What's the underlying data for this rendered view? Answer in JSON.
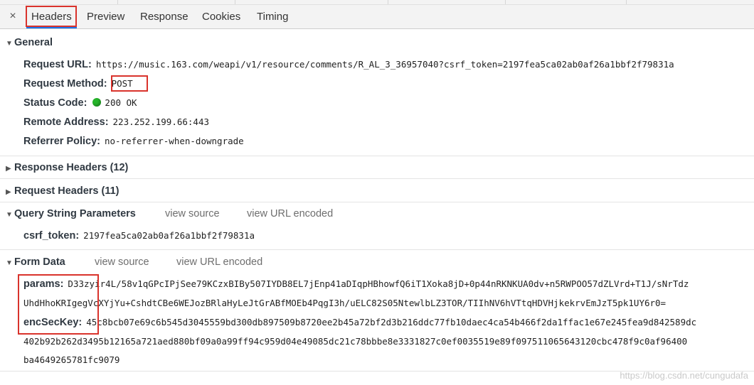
{
  "tabs": {
    "close": "×",
    "headers": "Headers",
    "preview": "Preview",
    "response": "Response",
    "cookies": "Cookies",
    "timing": "Timing"
  },
  "general": {
    "title": "General",
    "request_url_label": "Request URL:",
    "request_url": "https://music.163.com/weapi/v1/resource/comments/R_AL_3_36957040?csrf_token=2197fea5ca02ab0af26a1bbf2f79831a",
    "request_method_label": "Request Method:",
    "request_method": "POST",
    "status_code_label": "Status Code:",
    "status_code": "200 OK",
    "remote_address_label": "Remote Address:",
    "remote_address": "223.252.199.66:443",
    "referrer_policy_label": "Referrer Policy:",
    "referrer_policy": "no-referrer-when-downgrade"
  },
  "response_headers": {
    "title": "Response Headers (12)"
  },
  "request_headers": {
    "title": "Request Headers (11)"
  },
  "query_string": {
    "title": "Query String Parameters",
    "view_source": "view source",
    "view_url_encoded": "view URL encoded",
    "csrf_label": "csrf_token:",
    "csrf_value": "2197fea5ca02ab0af26a1bbf2f79831a"
  },
  "form_data": {
    "title": "Form Data",
    "view_source": "view source",
    "view_url_encoded": "view URL encoded",
    "params_label": "params:",
    "params_line1": "D33zyir4L/58v1qGPcIPjSee79KCzxBIBy507IYDB8EL7jEnp41aDIqpHBhowfQ6iT1Xoka8jD+0p44nRKNKUA0dv+n5RWPOO57dZLVrd+T1J/sNrTdz",
    "params_line2": "UhdHhoKRIgegVcXYjYu+CshdtCBe6WEJozBRlaHyLeJtGrABfMOEb4PqgI3h/uELC82S05NtewlbLZ3TOR/TIIhNV6hVTtqHDVHjkekrvEmJzT5pk1UY6r0=",
    "enc_label": "encSecKey:",
    "enc_line1": "45c8bcb07e69c6b545d3045559bd300db897509b8720ee2b45a72bf2d3b216ddc77fb10daec4ca54b466f2da1ffac1e67e245fea9d842589dc",
    "enc_line2": "402b92b262d3495b12165a721aed880bf09a0a99ff94c959d04e49085dc21c78bbbe8e3331827c0ef0035519e89f097511065643120cbc478f9c0af96400",
    "enc_line3": "ba4649265781fc9079"
  },
  "watermark": "https://blog.csdn.net/cungudafa",
  "colors": {
    "accent": "#1a73e8",
    "highlight": "#d9332c",
    "status_ok": "#25b52a"
  }
}
